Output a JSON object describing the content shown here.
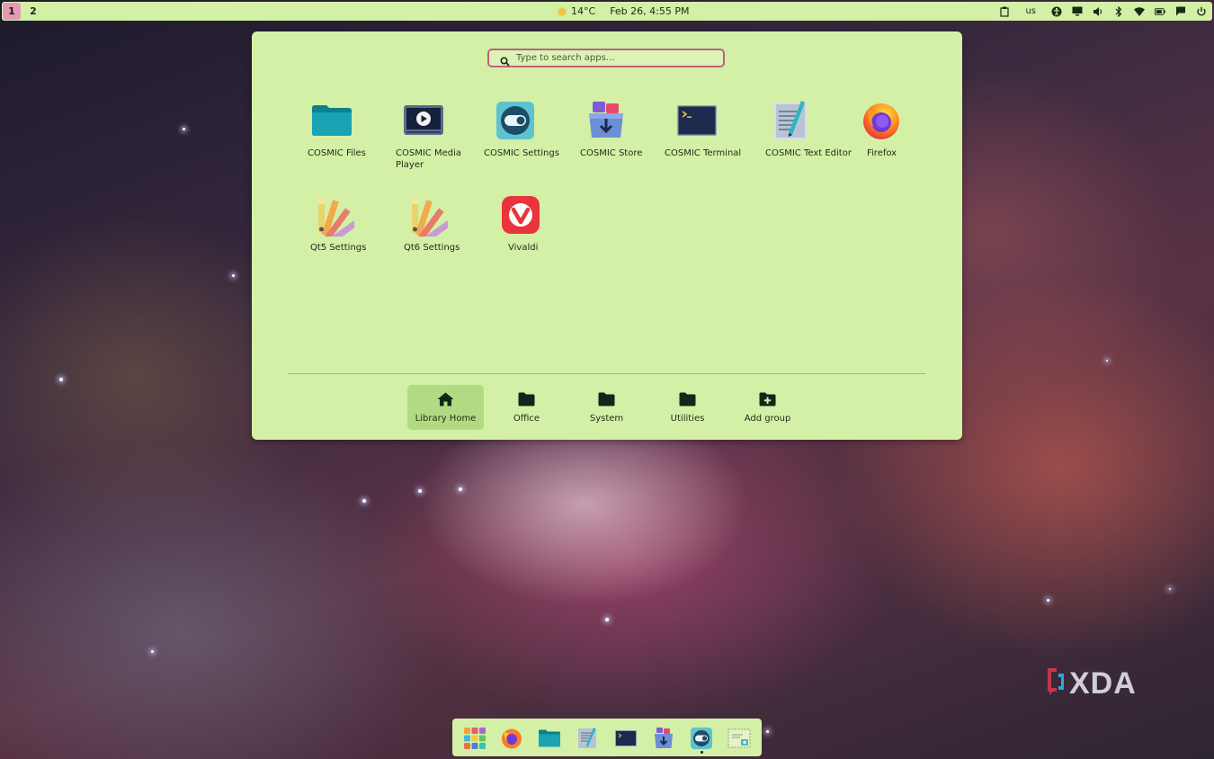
{
  "panel": {
    "workspaces": [
      "1",
      "2"
    ],
    "weather_temp": "14°C",
    "datetime": "Feb 26, 4:55 PM",
    "keyboard_layout": "us",
    "tray_icons": [
      "clipboard-icon",
      "accessibility-icon",
      "display-icon",
      "volume-icon",
      "bluetooth-icon",
      "wifi-icon",
      "battery-icon",
      "notifications-icon",
      "power-icon"
    ]
  },
  "launcher": {
    "search_placeholder": "Type to search apps...",
    "apps": [
      {
        "label": "COSMIC Files",
        "icon": "folder-icon"
      },
      {
        "label": "COSMIC Media Player",
        "icon": "media-player-icon"
      },
      {
        "label": "COSMIC Settings",
        "icon": "settings-toggle-icon"
      },
      {
        "label": "COSMIC Store",
        "icon": "store-icon"
      },
      {
        "label": "COSMIC Terminal",
        "icon": "terminal-icon"
      },
      {
        "label": "COSMIC Text Editor",
        "icon": "text-editor-icon"
      },
      {
        "label": "Firefox",
        "icon": "firefox-icon"
      },
      {
        "label": "Qt5 Settings",
        "icon": "qt-palette-icon"
      },
      {
        "label": "Qt6 Settings",
        "icon": "qt-palette-icon"
      },
      {
        "label": "Vivaldi",
        "icon": "vivaldi-icon"
      }
    ],
    "groups": [
      {
        "label": "Library Home",
        "icon": "home-icon",
        "active": true
      },
      {
        "label": "Office",
        "icon": "folder-icon"
      },
      {
        "label": "System",
        "icon": "folder-icon"
      },
      {
        "label": "Utilities",
        "icon": "folder-icon"
      },
      {
        "label": "Add group",
        "icon": "add-folder-icon"
      }
    ]
  },
  "dock": {
    "items": [
      "app-library-icon",
      "firefox-icon",
      "files-icon",
      "text-editor-icon",
      "terminal-icon",
      "store-icon",
      "settings-icon",
      "screenshot-icon"
    ]
  },
  "watermark": "XDA",
  "colors": {
    "panel_bg": "#d3f0a6",
    "accent": "#e49ab5",
    "active_group": "#b0db83"
  }
}
